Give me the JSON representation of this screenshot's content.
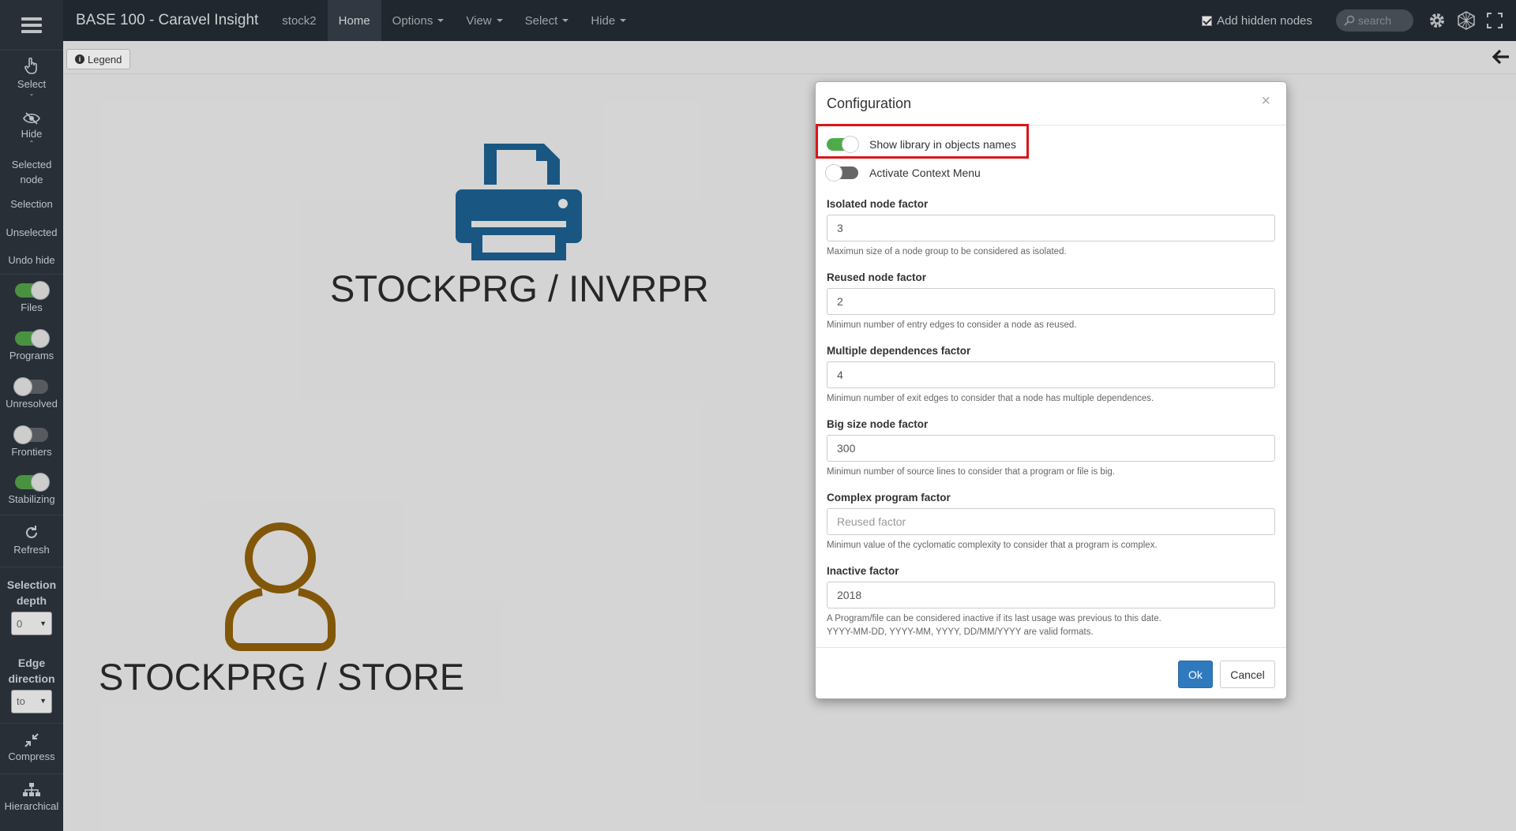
{
  "topbar": {
    "brand": "BASE 100 - Caravel Insight",
    "project": "stock2",
    "nav": [
      {
        "label": "Home",
        "active": true,
        "caret": false
      },
      {
        "label": "Options",
        "active": false,
        "caret": true
      },
      {
        "label": "View",
        "active": false,
        "caret": true
      },
      {
        "label": "Select",
        "active": false,
        "caret": true
      },
      {
        "label": "Hide",
        "active": false,
        "caret": true
      }
    ],
    "add_hidden_nodes": "Add hidden nodes",
    "search_placeholder": "search"
  },
  "subbar": {
    "legend": "Legend"
  },
  "sidebar": {
    "select": "Select",
    "hide": "Hide",
    "selected_node": "Selected node",
    "selection": "Selection",
    "unselected": "Unselected",
    "undo_hide": "Undo hide",
    "toggles": [
      {
        "label": "Files",
        "on": true
      },
      {
        "label": "Programs",
        "on": true
      },
      {
        "label": "Unresolved",
        "on": false
      },
      {
        "label": "Frontiers",
        "on": false
      },
      {
        "label": "Stabilizing",
        "on": true
      }
    ],
    "refresh": "Refresh",
    "selection_depth": "Selection depth",
    "selection_depth_value": "0",
    "edge_direction": "Edge direction",
    "edge_direction_value": "to",
    "compress": "Compress",
    "hierarchical": "Hierarchical"
  },
  "graph": {
    "node1_label": "STOCKPRG / INVRPR",
    "node2_label": "STOCKPRG / STORE",
    "node1_color": "#1b5c89",
    "node2_color": "#8a5c0a"
  },
  "modal": {
    "title": "Configuration",
    "close": "×",
    "options": [
      {
        "label": "Show library in objects names",
        "on": true
      },
      {
        "label": "Activate Context Menu",
        "on": false
      }
    ],
    "fields": [
      {
        "label": "Isolated node factor",
        "value": "3",
        "placeholder": "",
        "help": "Maximun size of a node group to be considered as isolated."
      },
      {
        "label": "Reused node factor",
        "value": "2",
        "placeholder": "",
        "help": "Minimun number of entry edges to consider a node as reused."
      },
      {
        "label": "Multiple dependences factor",
        "value": "4",
        "placeholder": "",
        "help": "Minimun number of exit edges to consider that a node has multiple dependences."
      },
      {
        "label": "Big size node factor",
        "value": "300",
        "placeholder": "",
        "help": "Minimun number of source lines to consider that a program or file is big."
      },
      {
        "label": "Complex program factor",
        "value": "",
        "placeholder": "Reused factor",
        "help": "Minimun value of the cyclomatic complexity to consider that a program is complex."
      },
      {
        "label": "Inactive factor",
        "value": "2018",
        "placeholder": "",
        "help": "A Program/file can be considered inactive if its last usage was previous to this date.",
        "help2": "YYYY-MM-DD, YYYY-MM, YYYY, DD/MM/YYYY are valid formats."
      }
    ],
    "ok": "Ok",
    "cancel": "Cancel"
  }
}
